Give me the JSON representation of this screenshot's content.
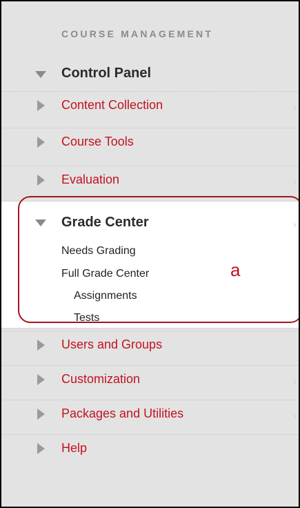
{
  "section_title": "COURSE MANAGEMENT",
  "control_panel": {
    "label": "Control Panel"
  },
  "menu": {
    "content_collection": "Content Collection",
    "course_tools": "Course Tools",
    "evaluation": "Evaluation",
    "users_and_groups": "Users and Groups",
    "customization": "Customization",
    "packages_and_utilities": "Packages and Utilities",
    "help": "Help"
  },
  "grade_center": {
    "title": "Grade Center",
    "needs_grading": "Needs Grading",
    "full_grade_center": "Full Grade Center",
    "assignments": "Assignments",
    "tests": "Tests"
  },
  "annotation": {
    "letter": "a"
  },
  "chevron": "›",
  "colors": {
    "link_red": "#c21220",
    "annotation_red": "#a3141c",
    "panel_gray": "#e3e3e3"
  }
}
